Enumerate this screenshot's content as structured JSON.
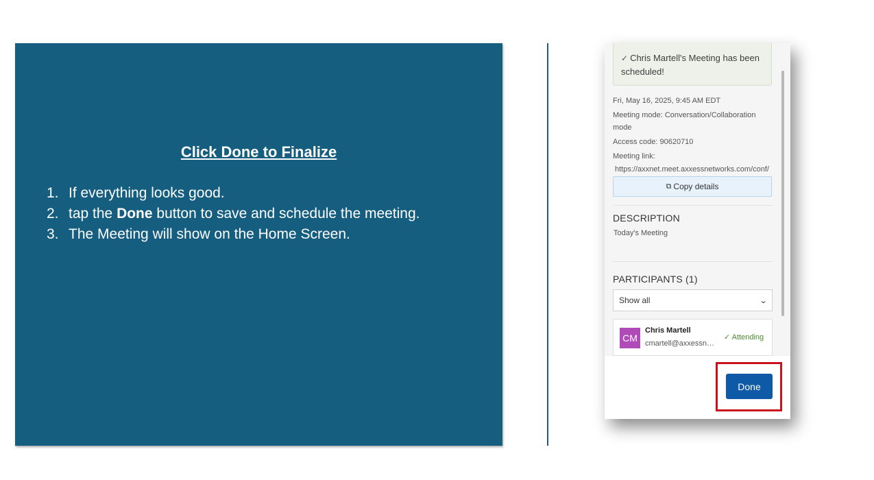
{
  "slide": {
    "title": "Click Done to Finalize",
    "steps": [
      {
        "num": "1.",
        "pre": "If everything looks good.",
        "bold": "",
        "post": ""
      },
      {
        "num": "2.",
        "pre": "tap the ",
        "bold": "Done",
        "post": " button to save and schedule the meeting."
      },
      {
        "num": "3.",
        "pre": "The Meeting will show on the Home Screen.",
        "bold": "",
        "post": ""
      }
    ]
  },
  "meeting": {
    "success_line1": "Chris Martell's Meeting has been",
    "success_line2": "scheduled!",
    "datetime": "Fri, May 16, 2025, 9:45 AM EDT",
    "mode_line1": "Meeting mode: Conversation/Collaboration",
    "mode_line2": "mode",
    "access_code": "Access code: 90620710",
    "link_label": "Meeting link:",
    "link_url": "https://axxnet.meet.axxessnetworks.com/conf/",
    "copy_label": "Copy details"
  },
  "description": {
    "heading": "DESCRIPTION",
    "text": "Today's  Meeting"
  },
  "participants": {
    "heading": "PARTICIPANTS (1)",
    "filter_value": "Show all",
    "items": [
      {
        "initials": "CM",
        "name": "Chris Martell",
        "email": "cmartell@axxessn…",
        "status": "Attending",
        "avatar_color": "#b04ab8"
      }
    ]
  },
  "footer": {
    "done_label": "Done"
  },
  "colors": {
    "slide_bg": "#155e80",
    "done_button": "#0e5aa7",
    "highlight": "#c8141c",
    "attending": "#4b8a2e"
  },
  "icons": {
    "success": "check-icon",
    "copy": "copy-icon",
    "dropdown": "chevron-down-icon",
    "status": "check-icon"
  }
}
